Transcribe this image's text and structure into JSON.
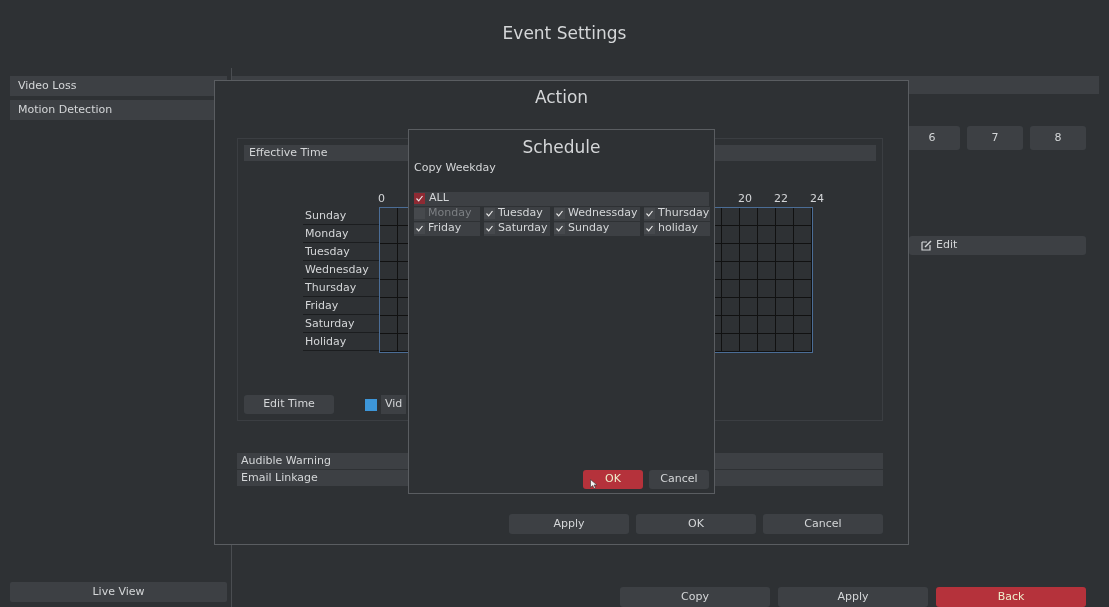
{
  "window": {
    "title": "Event Settings"
  },
  "sidebar": {
    "items": [
      {
        "label": "Video Loss"
      },
      {
        "label": "Motion Detection"
      }
    ],
    "live_view_button": "Live View"
  },
  "channel_buttons": [
    "6",
    "7",
    "8"
  ],
  "edit_button": "Edit",
  "footer_buttons": [
    {
      "label": "Copy",
      "kind": "default"
    },
    {
      "label": "Apply",
      "kind": "default"
    },
    {
      "label": "Back",
      "kind": "danger"
    }
  ],
  "action_dialog": {
    "title": "Action",
    "effective_time": {
      "header": "Effective Time",
      "hour_labels": [
        "0",
        "20",
        "22",
        "24"
      ],
      "days": [
        "Sunday",
        "Monday",
        "Tuesday",
        "Wednesday",
        "Thursday",
        "Friday",
        "Saturday",
        "Holiday"
      ],
      "edit_time_button": "Edit Time",
      "legend": {
        "label": "Vid",
        "color": "#3d96d8"
      }
    },
    "sections": [
      "Audible Warning",
      "Email Linkage"
    ],
    "buttons": [
      "Apply",
      "OK",
      "Cancel"
    ]
  },
  "schedule_dialog": {
    "title": "Schedule",
    "subtitle": "Copy Weekday",
    "all": {
      "label": "ALL",
      "checked": true
    },
    "days": [
      {
        "label": "Monday",
        "checked": false,
        "disabled": true
      },
      {
        "label": "Tuesday",
        "checked": true,
        "disabled": false
      },
      {
        "label": "Wednessday",
        "checked": true,
        "disabled": false
      },
      {
        "label": "Thursday",
        "checked": true,
        "disabled": false
      },
      {
        "label": "Friday",
        "checked": true,
        "disabled": false
      },
      {
        "label": "Saturday",
        "checked": true,
        "disabled": false
      },
      {
        "label": "Sunday",
        "checked": true,
        "disabled": false
      },
      {
        "label": "holiday",
        "checked": true,
        "disabled": false
      }
    ],
    "buttons": [
      {
        "label": "OK",
        "kind": "danger"
      },
      {
        "label": "Cancel",
        "kind": "default"
      }
    ]
  }
}
